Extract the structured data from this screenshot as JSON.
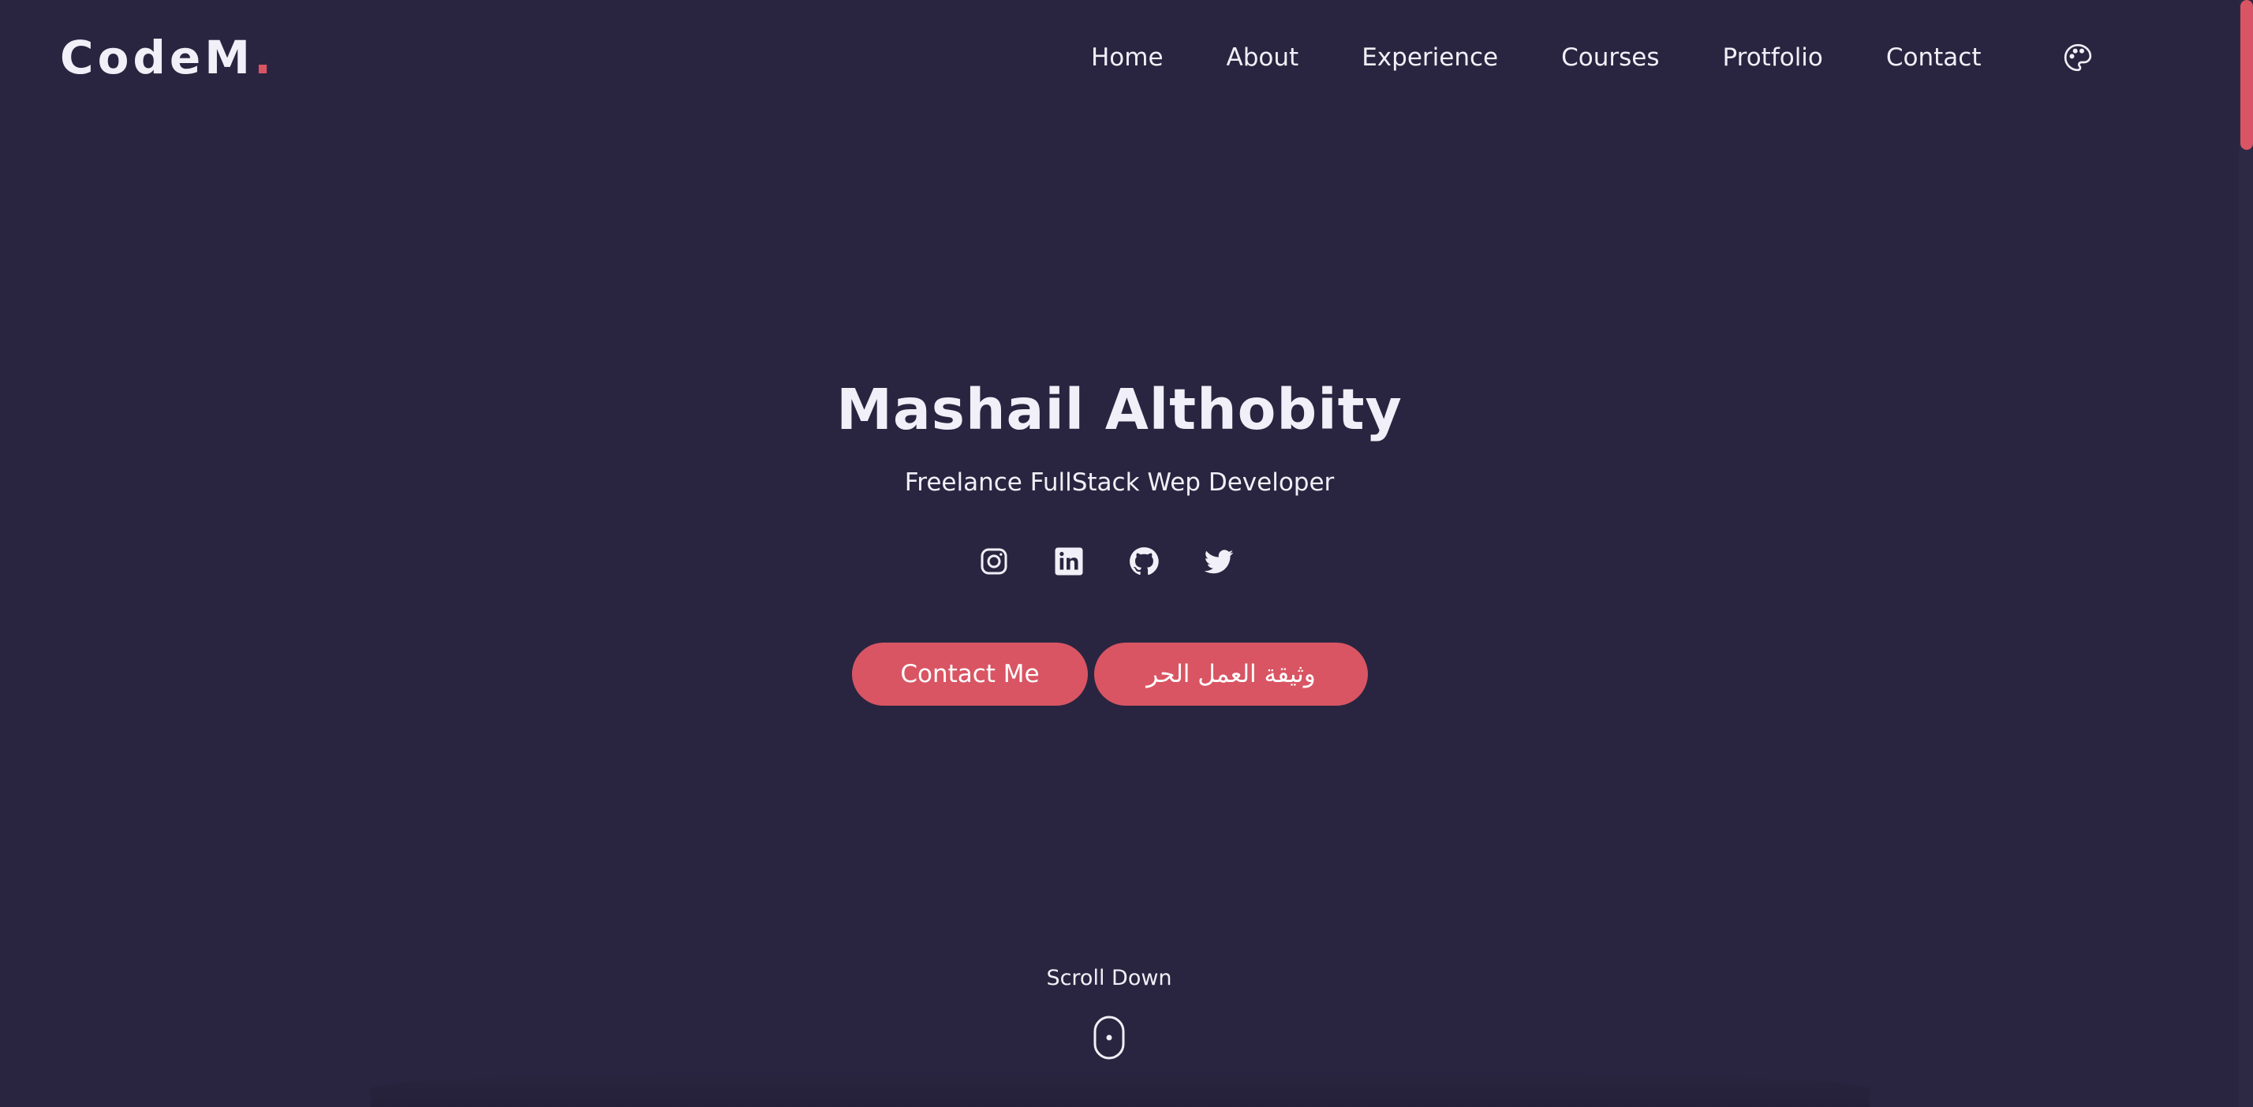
{
  "header": {
    "logo_text": "CodeM",
    "logo_dot": ".",
    "nav": [
      {
        "label": "Home"
      },
      {
        "label": "About"
      },
      {
        "label": "Experience"
      },
      {
        "label": "Courses"
      },
      {
        "label": "Protfolio"
      },
      {
        "label": "Contact"
      }
    ],
    "theme_icon": "palette-icon"
  },
  "hero": {
    "title": "Mashail Althobity",
    "subtitle": "Freelance FullStack Wep Developer",
    "socials": [
      {
        "icon": "instagram-icon"
      },
      {
        "icon": "linkedin-icon"
      },
      {
        "icon": "github-icon"
      },
      {
        "icon": "twitter-icon"
      }
    ],
    "buttons": {
      "contact_label": "Contact Me",
      "document_label": "وثيقة العمل الحر"
    }
  },
  "scroll": {
    "label": "Scroll Down",
    "icon": "mouse-icon"
  },
  "colors": {
    "background": "#292540",
    "accent": "#d95563",
    "text": "#f1eff7"
  }
}
